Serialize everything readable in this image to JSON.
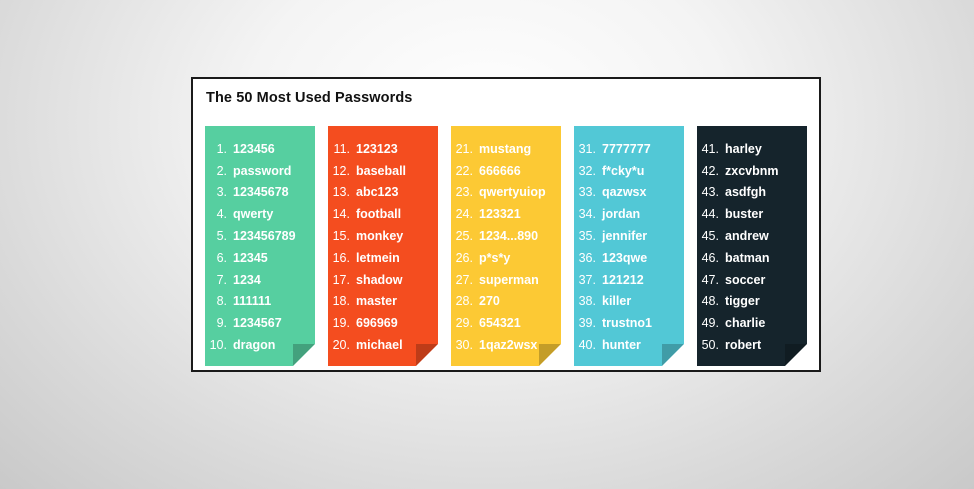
{
  "title": "The 50 Most Used Passwords",
  "colors": [
    "#56cfa0",
    "#f44d1f",
    "#fcc934",
    "#52c8d6",
    "#15242c"
  ],
  "columns": [
    {
      "entries": [
        {
          "num": "1.",
          "pw": "123456"
        },
        {
          "num": "2.",
          "pw": "password"
        },
        {
          "num": "3.",
          "pw": "12345678"
        },
        {
          "num": "4.",
          "pw": "qwerty"
        },
        {
          "num": "5.",
          "pw": "123456789"
        },
        {
          "num": "6.",
          "pw": "12345"
        },
        {
          "num": "7.",
          "pw": "1234"
        },
        {
          "num": "8.",
          "pw": "111111"
        },
        {
          "num": "9.",
          "pw": "1234567"
        },
        {
          "num": "10.",
          "pw": "dragon"
        }
      ]
    },
    {
      "entries": [
        {
          "num": "11.",
          "pw": "123123"
        },
        {
          "num": "12.",
          "pw": "baseball"
        },
        {
          "num": "13.",
          "pw": "abc123"
        },
        {
          "num": "14.",
          "pw": "football"
        },
        {
          "num": "15.",
          "pw": "monkey"
        },
        {
          "num": "16.",
          "pw": "letmein"
        },
        {
          "num": "17.",
          "pw": "shadow"
        },
        {
          "num": "18.",
          "pw": "master"
        },
        {
          "num": "19.",
          "pw": "696969"
        },
        {
          "num": "20.",
          "pw": "michael"
        }
      ]
    },
    {
      "entries": [
        {
          "num": "21.",
          "pw": "mustang"
        },
        {
          "num": "22.",
          "pw": "666666"
        },
        {
          "num": "23.",
          "pw": "qwertyuiop"
        },
        {
          "num": "24.",
          "pw": "123321"
        },
        {
          "num": "25.",
          "pw": "1234...890"
        },
        {
          "num": "26.",
          "pw": "p*s*y"
        },
        {
          "num": "27.",
          "pw": "superman"
        },
        {
          "num": "28.",
          "pw": "270"
        },
        {
          "num": "29.",
          "pw": "654321"
        },
        {
          "num": "30.",
          "pw": "1qaz2wsx"
        }
      ]
    },
    {
      "entries": [
        {
          "num": "31.",
          "pw": "7777777"
        },
        {
          "num": "32.",
          "pw": "f*cky*u"
        },
        {
          "num": "33.",
          "pw": "qazwsx"
        },
        {
          "num": "34.",
          "pw": "jordan"
        },
        {
          "num": "35.",
          "pw": "jennifer"
        },
        {
          "num": "36.",
          "pw": "123qwe"
        },
        {
          "num": "37.",
          "pw": "121212"
        },
        {
          "num": "38.",
          "pw": "killer"
        },
        {
          "num": "39.",
          "pw": "trustno1"
        },
        {
          "num": "40.",
          "pw": "hunter"
        }
      ]
    },
    {
      "entries": [
        {
          "num": "41.",
          "pw": "harley"
        },
        {
          "num": "42.",
          "pw": "zxcvbnm"
        },
        {
          "num": "43.",
          "pw": "asdfgh"
        },
        {
          "num": "44.",
          "pw": "buster"
        },
        {
          "num": "45.",
          "pw": "andrew"
        },
        {
          "num": "46.",
          "pw": "batman"
        },
        {
          "num": "47.",
          "pw": "soccer"
        },
        {
          "num": "48.",
          "pw": "tigger"
        },
        {
          "num": "49.",
          "pw": "charlie"
        },
        {
          "num": "50.",
          "pw": "robert"
        }
      ]
    }
  ]
}
